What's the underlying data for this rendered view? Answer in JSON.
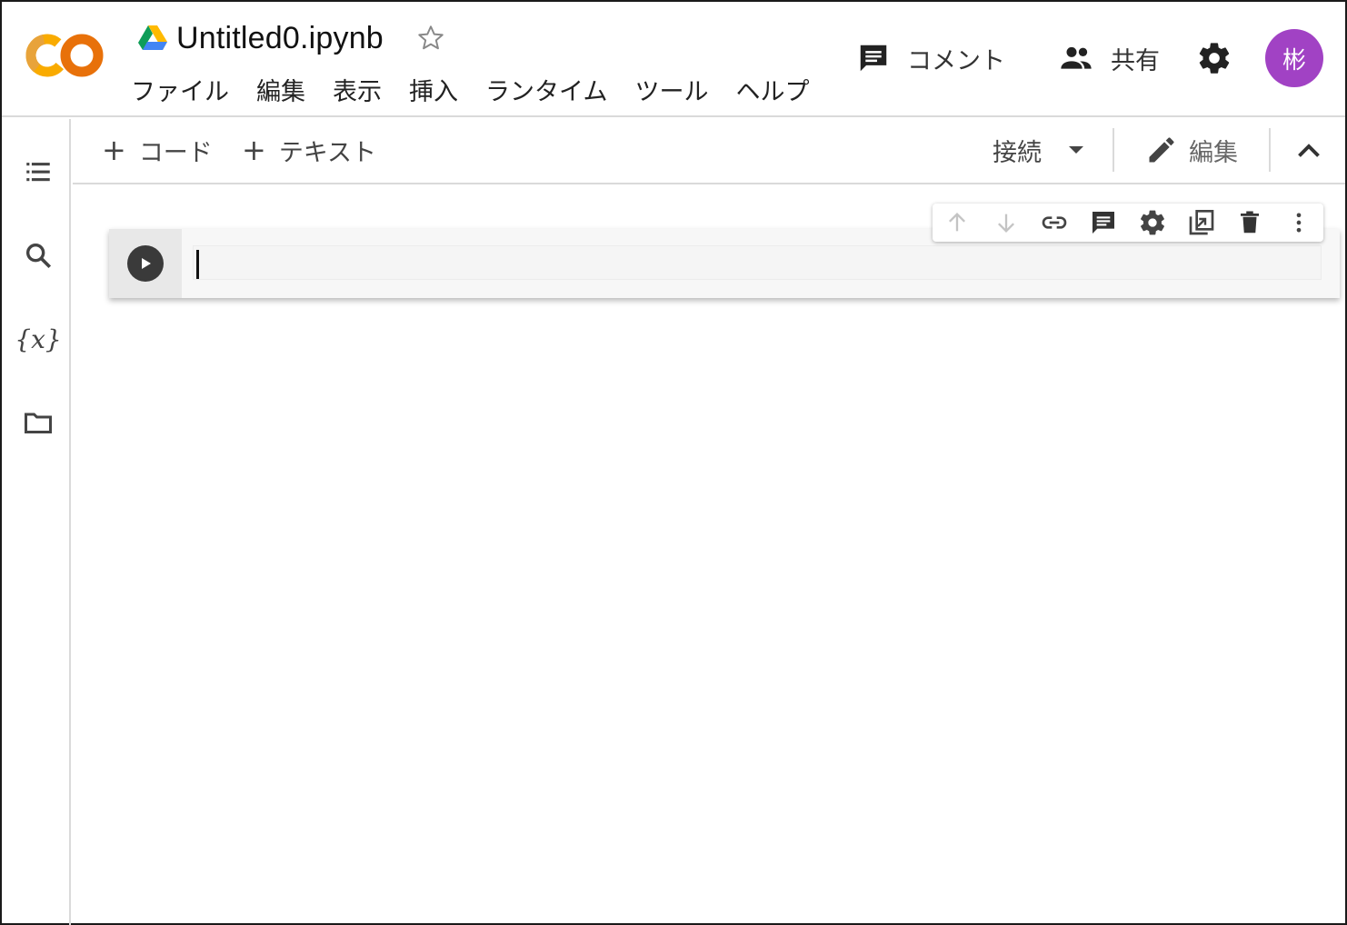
{
  "header": {
    "title": "Untitled0.ipynb",
    "logo_text": "CO",
    "menu": [
      "ファイル",
      "編集",
      "表示",
      "挿入",
      "ランタイム",
      "ツール",
      "ヘルプ"
    ],
    "comment_label": "コメント",
    "share_label": "共有",
    "avatar_initial": "彬",
    "avatar_color": "#a142c4"
  },
  "toolbar": {
    "add_code": "コード",
    "add_text": "テキスト",
    "connect_label": "接続",
    "edit_label": "編集"
  },
  "sidebar": {
    "icons": [
      "toc-icon",
      "search-icon",
      "variables-icon",
      "folder-icon"
    ],
    "variables_glyph": "{x}"
  },
  "cell": {
    "code": "",
    "toolbar_icons": [
      "move-up-icon",
      "move-down-icon",
      "link-icon",
      "comment-icon",
      "settings-icon",
      "mirror-cell-icon",
      "delete-icon",
      "more-icon"
    ]
  },
  "colors": {
    "logo_orange": "#e8a33a",
    "logo_dark_orange": "#e37400",
    "accent_purple": "#a142c4"
  }
}
